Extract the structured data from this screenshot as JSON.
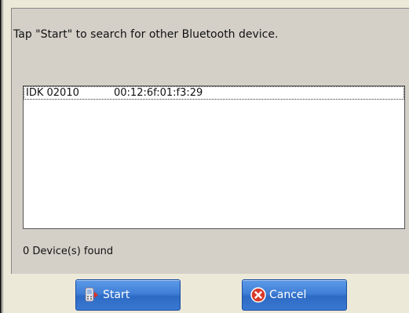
{
  "dialog": {
    "instruction": "Tap \"Start\" to search for other Bluetooth device."
  },
  "device_list": {
    "rows": [
      {
        "name": "IDK 02010",
        "address": "00:12:6f:01:f3:29",
        "selected": true
      }
    ]
  },
  "status": {
    "text": "0 Device(s) found"
  },
  "buttons": {
    "start_label": "Start",
    "start_icon": "bluetooth-device-icon",
    "cancel_label": "Cancel",
    "cancel_icon": "cancel-x-icon"
  },
  "colors": {
    "button_blue": "#3f7fd6",
    "cancel_red": "#d83a2a"
  }
}
